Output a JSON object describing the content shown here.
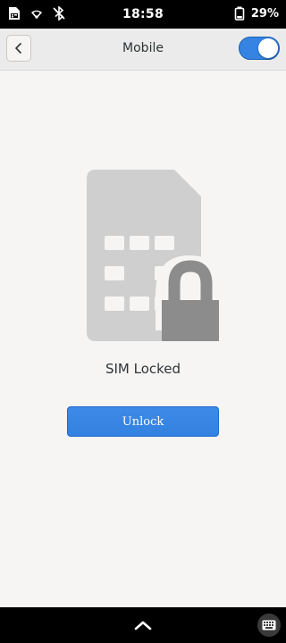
{
  "status_bar": {
    "time": "18:58",
    "battery_percent": "29%",
    "icons": [
      "sim-icon",
      "wifi-icon",
      "bluetooth-off-icon",
      "battery-icon"
    ]
  },
  "header": {
    "title": "Mobile",
    "back_icon": "chevron-left-icon",
    "toggle_on": true
  },
  "main": {
    "illustration": "sim-locked-icon",
    "status_title": "SIM Locked",
    "unlock_label": "Unlock"
  },
  "bottom_bar": {
    "home_icon": "chevron-up-icon",
    "keyboard_icon": "keyboard-icon"
  },
  "colors": {
    "accent": "#3584e4",
    "background": "#f6f5f4",
    "sim_gray": "#cfcfcf",
    "lock_gray": "#8c8c8c"
  }
}
